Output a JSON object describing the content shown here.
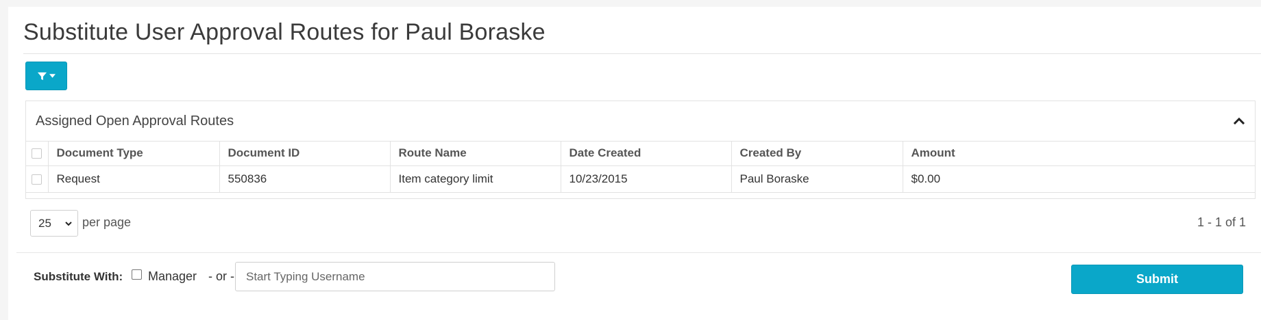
{
  "page": {
    "title": "Substitute User Approval Routes for Paul Boraske"
  },
  "toolbar": {
    "filter_icon": "filter-icon",
    "filter_caret_icon": "caret-down-icon"
  },
  "panel": {
    "title": "Assigned Open Approval Routes",
    "collapse_icon": "chevron-up-icon"
  },
  "table": {
    "columns": [
      "Document Type",
      "Document ID",
      "Route Name",
      "Date Created",
      "Created By",
      "Amount"
    ],
    "rows": [
      {
        "document_type": "Request",
        "document_id": "550836",
        "route_name": "Item category limit",
        "date_created": "10/23/2015",
        "created_by": "Paul Boraske",
        "amount": "$0.00"
      }
    ]
  },
  "pagination": {
    "per_page_value": "25",
    "per_page_label": "per page",
    "count_text": "1 - 1 of 1"
  },
  "substitute": {
    "label": "Substitute With:",
    "manager_label": "Manager",
    "or_label": "- or -",
    "username_placeholder": "Start Typing Username",
    "username_value": "",
    "submit_label": "Submit"
  },
  "colors": {
    "accent": "#0aa7c9",
    "border": "#e2e2e2",
    "background": "#f5f5f5"
  }
}
